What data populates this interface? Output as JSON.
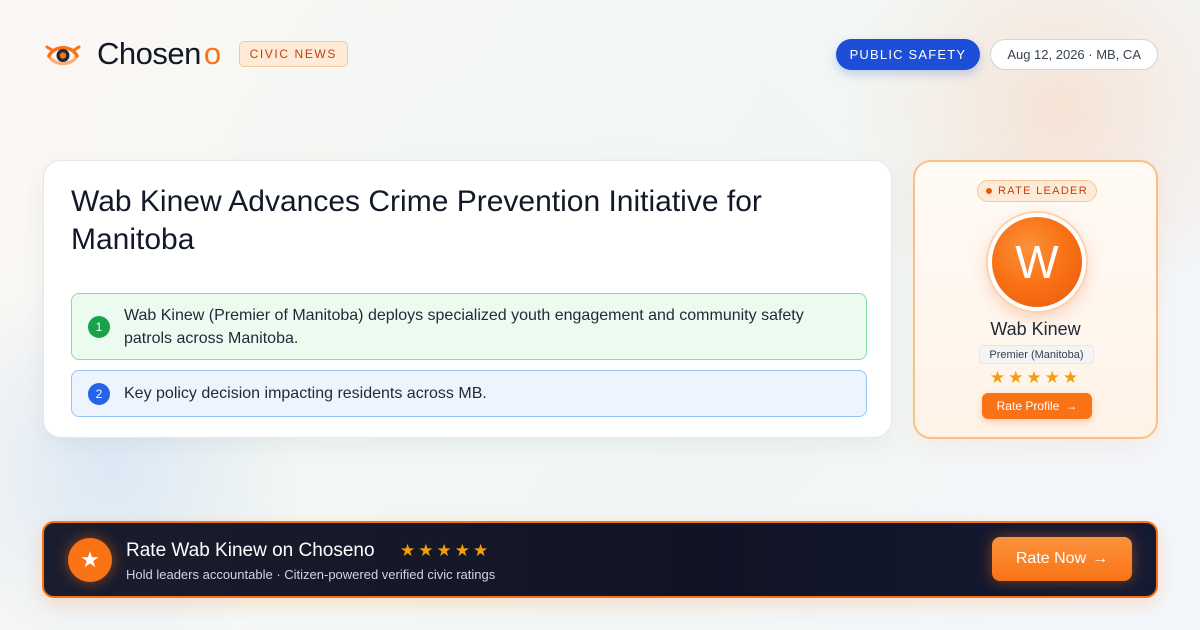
{
  "brand": {
    "name": "Choseno",
    "name_main": "Chosen",
    "name_accent": "o",
    "section_badge": "CIVIC NEWS",
    "accent_color": "#f97316"
  },
  "header": {
    "category": "PUBLIC SAFETY",
    "date_location": "Aug 12, 2026 · MB, CA"
  },
  "article": {
    "headline": "Wab Kinew Advances Crime Prevention Initiative for Manitoba",
    "points": [
      {
        "number": "1",
        "text": "Wab Kinew (Premier of Manitoba) deploys specialized youth engagement and community safety patrols across Manitoba."
      },
      {
        "number": "2",
        "text": "Key policy decision impacting residents across MB."
      }
    ]
  },
  "leader_card": {
    "badge": "RATE LEADER",
    "avatar_initial": "W",
    "name": "Wab Kinew",
    "role": "Premier (Manitoba)",
    "stars": "★★★★★",
    "rating_value": 5,
    "rating_max": 5,
    "button_label": "Rate Profile",
    "button_arrow": "→"
  },
  "banner": {
    "icon": "star-icon",
    "title": "Rate Wab Kinew on Choseno",
    "stars": "★★★★★",
    "subtitle": "Hold leaders accountable · Citizen-powered verified civic ratings",
    "button_label": "Rate Now",
    "button_arrow": "→"
  }
}
